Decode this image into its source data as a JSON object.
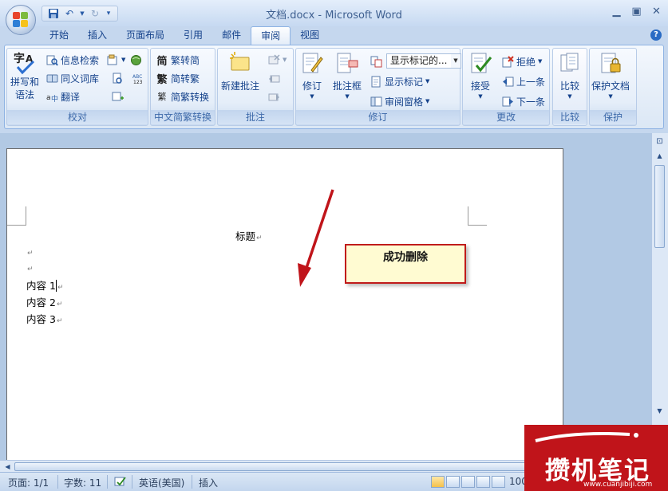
{
  "window": {
    "title": "文档.docx - Microsoft Word"
  },
  "tabs": [
    "开始",
    "插入",
    "页面布局",
    "引用",
    "邮件",
    "审阅",
    "视图"
  ],
  "active_tab": "审阅",
  "ribbon": {
    "groups": {
      "proofing": {
        "label": "校对",
        "spelling_line1": "拼写和",
        "spelling_line2": "语法",
        "research": "信息检索",
        "thesaurus": "同义词库",
        "translate": "翻译"
      },
      "chinese_conversion": {
        "label": "中文简繁转换",
        "to_simplified": "繁转简",
        "to_traditional": "简转繁",
        "convert": "简繁转换"
      },
      "comments": {
        "label": "批注",
        "new_comment": "新建批注"
      },
      "tracking": {
        "label": "修订",
        "track_changes": "修订",
        "balloons": "批注框",
        "display_dropdown": "显示标记的...",
        "show_markup": "显示标记",
        "reviewing_pane": "审阅窗格"
      },
      "changes": {
        "label": "更改",
        "accept": "接受",
        "reject": "拒绝",
        "previous": "上一条",
        "next": "下一条"
      },
      "compare": {
        "label": "比较",
        "compare": "比较"
      },
      "protect": {
        "label": "保护",
        "protect_document": "保护文档"
      }
    }
  },
  "document": {
    "title_line": "标题",
    "lines": [
      "内容 1",
      "内容 2",
      "内容 3"
    ]
  },
  "callout": {
    "text": "成功删除"
  },
  "statusbar": {
    "page": "页面: 1/1",
    "words": "字数: 11",
    "language": "英语(美国)",
    "mode": "插入",
    "zoom": "100"
  },
  "watermark": {
    "text": "攒机笔记",
    "url": "www.cuanjibiji.com"
  },
  "colors": {
    "ribbon_accent": "#15428b",
    "callout_border": "#c01b1b",
    "arrow": "#c0141a",
    "watermark_bg": "#c0141a"
  }
}
